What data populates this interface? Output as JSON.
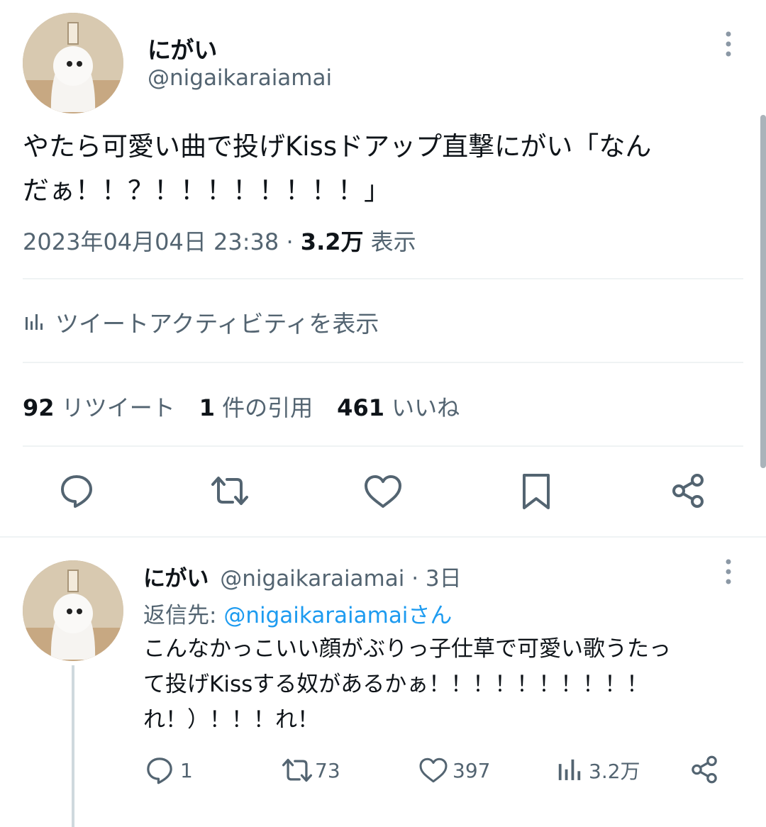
{
  "main_tweet": {
    "display_name": "にがい",
    "handle": "@nigaikaraiamai",
    "text_line1": "やたら可愛い曲で投げKissドアップ直撃にがい「なん",
    "text_line2": "だぁ！！？！！！！！！！！」",
    "timestamp": "2023年04月04日 23:38",
    "separator": "·",
    "views_count": "3.2万",
    "views_label": "表示",
    "activity_label": "ツイートアクティビティを表示",
    "stats": {
      "retweets_count": "92",
      "retweets_label": "リツイート",
      "quotes_count": "1",
      "quotes_label": "件の引用",
      "likes_count": "461",
      "likes_label": "いいね"
    }
  },
  "reply_tweet": {
    "display_name": "にがい",
    "handle": "@nigaikaraiamai",
    "time": "· 3日",
    "reply_to_prefix": "返信先: ",
    "reply_to_handle": "@nigaikaraiamai",
    "reply_to_suffix": "さん",
    "text_line1": "こんなかっこいい顔がぶりっ子仕草で可愛い歌うたっ",
    "text_line2": "て投げKissする奴があるかぁ！！！！！！！！！！",
    "text_line3": "れ！）！！！れ！",
    "actions": {
      "replies": "1",
      "retweets": "73",
      "likes": "397",
      "views": "3.2万"
    }
  },
  "icons": [
    "more-icon",
    "chart-icon",
    "reply-icon",
    "retweet-icon",
    "like-icon",
    "bookmark-icon",
    "share-icon"
  ],
  "colors": {
    "text": "#0f1419",
    "muted": "#536471",
    "link": "#1d9bf0",
    "divider": "#eff3f4"
  }
}
